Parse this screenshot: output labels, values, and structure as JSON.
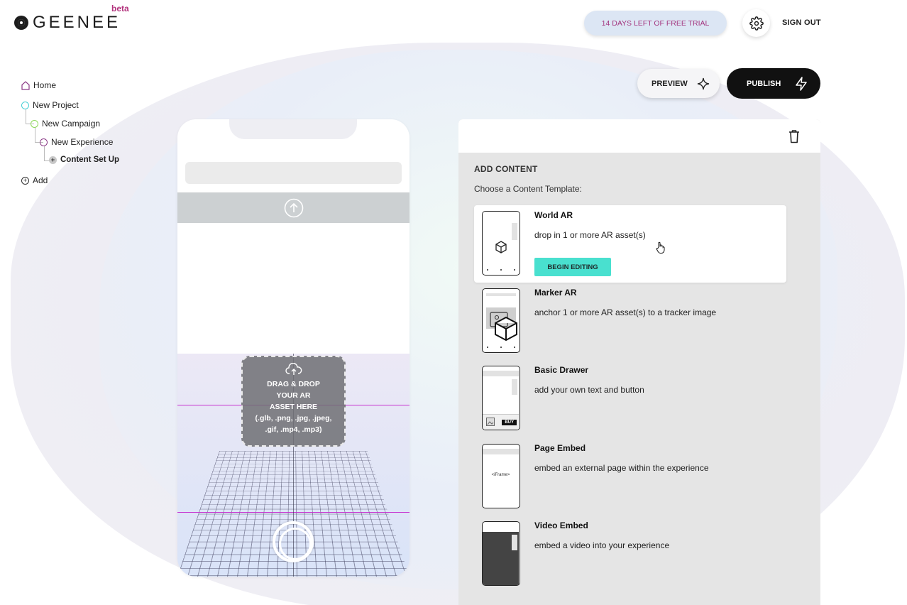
{
  "brand": {
    "name": "GEENEE",
    "badge": "beta"
  },
  "header": {
    "trial": "14 DAYS LEFT OF FREE TRIAL",
    "settings_icon": "gear-icon",
    "sign_out": "SIGN OUT"
  },
  "colors": {
    "accent_teal": "#49e0cf",
    "brand_magenta": "#b3347e",
    "publish_bg": "#111111"
  },
  "sidebar": {
    "home": "Home",
    "project": "New Project",
    "campaign": "New Campaign",
    "experience": "New Experience",
    "content": "Content Set Up",
    "add": "Add"
  },
  "toolbar": {
    "preview": "PREVIEW",
    "publish": "PUBLISH"
  },
  "phone": {
    "drop_lines": [
      "DRAG & DROP",
      "YOUR AR",
      "ASSET HERE",
      "(.glb, .png, .jpg, .jpeg,",
      ".gif, .mp4, .mp3)"
    ]
  },
  "panel": {
    "title": "ADD CONTENT",
    "subtitle": "Choose a Content Template:",
    "templates": [
      {
        "name": "World AR",
        "desc": "drop in 1 or more AR asset(s)",
        "action": "BEGIN EDITING"
      },
      {
        "name": "Marker AR",
        "desc": "anchor 1 or more AR asset(s) to a tracker image"
      },
      {
        "name": "Basic Drawer",
        "desc": "add your own text and button",
        "thumb_button": "BUY"
      },
      {
        "name": "Page Embed",
        "desc": "embed an external page within the experience",
        "thumb_label": "<iFrame>"
      },
      {
        "name": "Video Embed",
        "desc": "embed a video into your experience"
      }
    ]
  }
}
